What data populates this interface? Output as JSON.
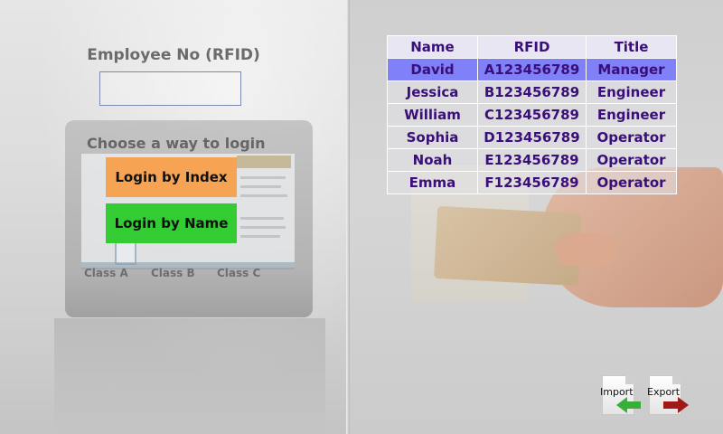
{
  "login": {
    "employee_label": "Employee No (RFID)",
    "employee_value": "",
    "choose_label": "Choose a way to login",
    "btn_index": "Login by Index",
    "btn_name": "Login by Name",
    "classes": [
      "Class A",
      "Class B",
      "Class C"
    ],
    "colors": {
      "btn_index": "#f6a353",
      "btn_name": "#33cc33"
    }
  },
  "table": {
    "headers": [
      "Name",
      "RFID",
      "Title"
    ],
    "rows": [
      [
        "David",
        "A123456789",
        "Manager"
      ],
      [
        "Jessica",
        "B123456789",
        "Engineer"
      ],
      [
        "William",
        "C123456789",
        "Engineer"
      ],
      [
        "Sophia",
        "D123456789",
        "Operator"
      ],
      [
        "Noah",
        "E123456789",
        "Operator"
      ],
      [
        "Emma",
        "F123456789",
        "Operator"
      ]
    ],
    "selected_row": 0,
    "colors": {
      "text": "#3a0f7a",
      "selected": "#8080f8"
    }
  },
  "actions": {
    "import_label": "Import",
    "export_label": "Export",
    "import_icon": "document-arrow-left-icon",
    "export_icon": "document-arrow-right-icon"
  }
}
